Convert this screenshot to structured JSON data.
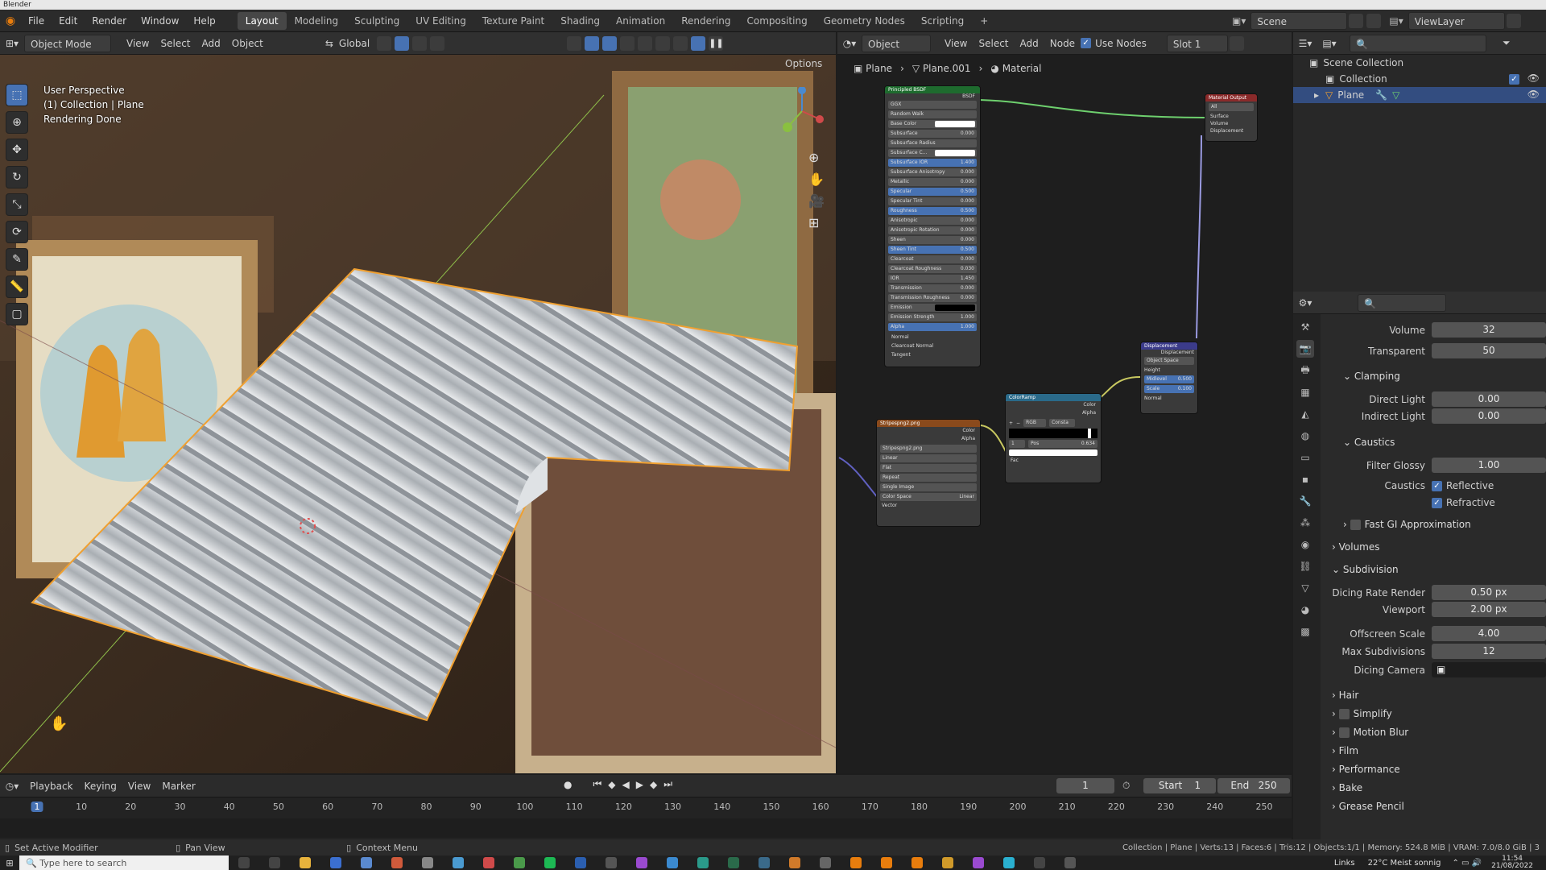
{
  "app": {
    "title": "Blender"
  },
  "menus": [
    "File",
    "Edit",
    "Render",
    "Window",
    "Help"
  ],
  "workspaces": [
    "Layout",
    "Modeling",
    "Sculpting",
    "UV Editing",
    "Texture Paint",
    "Shading",
    "Animation",
    "Rendering",
    "Compositing",
    "Geometry Nodes",
    "Scripting"
  ],
  "active_workspace": "Layout",
  "scene": {
    "label": "Scene",
    "view_layer": "ViewLayer"
  },
  "viewport": {
    "mode": "Object Mode",
    "menus": [
      "View",
      "Select",
      "Add",
      "Object"
    ],
    "orientation": "Global",
    "options_label": "Options",
    "overlay_text": [
      "User Perspective",
      "(1) Collection | Plane",
      "Rendering Done"
    ]
  },
  "node_editor": {
    "type": "Object",
    "menus": [
      "View",
      "Select",
      "Add",
      "Node"
    ],
    "use_nodes_label": "Use Nodes",
    "slot": "Slot 1",
    "breadcrumb": [
      "Plane",
      "Plane.001",
      "Material"
    ],
    "nodes": {
      "principled": {
        "title": "Principled BSDF",
        "output": "BSDF",
        "rows": [
          {
            "label": "GGX",
            "value": ""
          },
          {
            "label": "Random Walk",
            "value": ""
          },
          {
            "label": "Base Color",
            "value": ""
          },
          {
            "label": "Subsurface",
            "value": "0.000"
          },
          {
            "label": "Subsurface Radius",
            "value": ""
          },
          {
            "label": "Subsurface C...",
            "value": ""
          },
          {
            "label": "Subsurface IOR",
            "value": "1.400"
          },
          {
            "label": "Subsurface Anisotropy",
            "value": "0.000"
          },
          {
            "label": "Metallic",
            "value": "0.000"
          },
          {
            "label": "Specular",
            "value": "0.500"
          },
          {
            "label": "Specular Tint",
            "value": "0.000"
          },
          {
            "label": "Roughness",
            "value": "0.500"
          },
          {
            "label": "Anisotropic",
            "value": "0.000"
          },
          {
            "label": "Anisotropic Rotation",
            "value": "0.000"
          },
          {
            "label": "Sheen",
            "value": "0.000"
          },
          {
            "label": "Sheen Tint",
            "value": "0.500"
          },
          {
            "label": "Clearcoat",
            "value": "0.000"
          },
          {
            "label": "Clearcoat Roughness",
            "value": "0.030"
          },
          {
            "label": "IOR",
            "value": "1.450"
          },
          {
            "label": "Transmission",
            "value": "0.000"
          },
          {
            "label": "Transmission Roughness",
            "value": "0.000"
          },
          {
            "label": "Emission",
            "value": ""
          },
          {
            "label": "Emission Strength",
            "value": "1.000"
          },
          {
            "label": "Alpha",
            "value": "1.000"
          }
        ],
        "inputs": [
          "Normal",
          "Clearcoat Normal",
          "Tangent"
        ]
      },
      "output": {
        "title": "Material Output",
        "target": "All",
        "sockets": [
          "Surface",
          "Volume",
          "Displacement"
        ]
      },
      "image": {
        "title": "Stripespng2.png",
        "outputs": [
          "Color",
          "Alpha"
        ],
        "file": "Stripespng2.png",
        "rows": [
          "Linear",
          "Flat",
          "Repeat",
          "Single Image"
        ],
        "color_space_label": "Color Space",
        "color_space": "Linear",
        "input": "Vector"
      },
      "ramp": {
        "title": "ColorRamp",
        "outputs": [
          "Color",
          "Alpha"
        ],
        "mode": "RGB",
        "interp": "Consta",
        "index": "1",
        "pos_label": "Pos",
        "pos": "0.634",
        "input": "Fac"
      },
      "displacement": {
        "title": "Displacement",
        "output": "Displacement",
        "space": "Object Space",
        "rows": [
          {
            "label": "Height",
            "value": ""
          },
          {
            "label": "Midlevel",
            "value": "0.500"
          },
          {
            "label": "Scale",
            "value": "0.100"
          },
          {
            "label": "Normal",
            "value": ""
          }
        ]
      }
    }
  },
  "outliner": {
    "root": "Scene Collection",
    "items": [
      {
        "label": "Collection"
      },
      {
        "label": "Plane"
      }
    ]
  },
  "properties": {
    "rows_top": [
      {
        "label": "Volume",
        "value": "32"
      },
      {
        "label": "Transparent",
        "value": "50"
      }
    ],
    "clamping": {
      "title": "Clamping",
      "rows": [
        {
          "label": "Direct Light",
          "value": "0.00"
        },
        {
          "label": "Indirect Light",
          "value": "0.00"
        }
      ]
    },
    "caustics": {
      "title": "Caustics",
      "filter_glossy_label": "Filter Glossy",
      "filter_glossy": "1.00",
      "caustics_label": "Caustics",
      "checks": [
        "Reflective",
        "Refractive"
      ]
    },
    "fast_gi": "Fast GI Approximation",
    "volumes": "Volumes",
    "subdivision": {
      "title": "Subdivision",
      "rows": [
        {
          "label": "Dicing Rate Render",
          "value": "0.50 px"
        },
        {
          "label": "Viewport",
          "value": "2.00 px"
        },
        {
          "label": "Offscreen Scale",
          "value": "4.00"
        },
        {
          "label": "Max Subdivisions",
          "value": "12"
        }
      ],
      "dicing_camera_label": "Dicing Camera"
    },
    "sections": [
      {
        "label": "Hair",
        "check": false
      },
      {
        "label": "Simplify",
        "check": true
      },
      {
        "label": "Motion Blur",
        "check": true
      },
      {
        "label": "Film",
        "check": false
      },
      {
        "label": "Performance",
        "check": false
      },
      {
        "label": "Bake",
        "check": false
      },
      {
        "label": "Grease Pencil",
        "check": false
      }
    ]
  },
  "timeline": {
    "menus": [
      "Playback",
      "Keying",
      "View",
      "Marker"
    ],
    "current_frame": "1",
    "start_label": "Start",
    "start": "1",
    "end_label": "End",
    "end": "250",
    "ticks": [
      "1",
      "10",
      "20",
      "30",
      "40",
      "50",
      "60",
      "70",
      "80",
      "90",
      "100",
      "110",
      "120",
      "130",
      "140",
      "150",
      "160",
      "170",
      "180",
      "190",
      "200",
      "210",
      "220",
      "230",
      "240",
      "250"
    ]
  },
  "statusbar": {
    "left": [
      "Set Active Modifier",
      "Pan View",
      "Context Menu"
    ],
    "right": "Collection | Plane | Verts:13 | Faces:6 | Tris:12 | Objects:1/1 | Memory: 524.8 MiB | VRAM: 7.0/8.0 GiB | 3"
  },
  "taskbar": {
    "search_placeholder": "Type here to search",
    "links": "Links",
    "weather": "22°C  Meist sonnig",
    "time": "11:54",
    "date": "21/08/2022"
  },
  "colors": {
    "accent": "#4772b3",
    "selection": "#f0a030",
    "header_bsdf": "#1e6b2e",
    "header_texture": "#8a4a1c",
    "header_converter": "#2a6a8a",
    "header_vector": "#3b3b8a",
    "header_output": "#8a2a2a"
  }
}
